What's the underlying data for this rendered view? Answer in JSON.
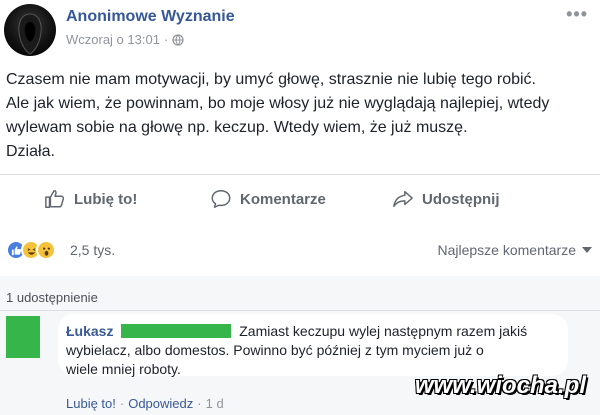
{
  "post": {
    "author": "Anonimowe Wyznanie",
    "timestamp": "Wczoraj o 13:01",
    "separator": "·",
    "more": "•••",
    "text_lines": [
      "Czasem nie mam motywacji, by umyć głowę, strasznie nie lubię tego robić.",
      "Ale jak wiem, że powinnam, bo moje włosy już nie wyglądają najlepiej, wtedy",
      "wylewam sobie na głowę np. keczup. Wtedy wiem, że już muszę.",
      "Działa."
    ]
  },
  "actions": {
    "like": "Lubię to!",
    "comment": "Komentarze",
    "share": "Udostępnij"
  },
  "reactions": {
    "types": [
      "like",
      "haha",
      "wow"
    ],
    "count": "2,5 tys.",
    "sort_label": "Najlepsze komentarze"
  },
  "shares": "1 udostępnienie",
  "comment": {
    "author": "Łukasz",
    "text_lines": [
      "Zamiast keczupu wylej następnym razem jakiś",
      "wybielacz, albo domestos. Powinno być później z tym myciem już o",
      "wiele mniej roboty."
    ],
    "like": "Lubię to!",
    "reply": "Odpowiedz",
    "time": "1 d"
  },
  "watermark": "www.wiocha.pl",
  "colors": {
    "link_blue": "#365899",
    "gray_text": "#606770",
    "redaction_green": "#36b54a",
    "comment_bg": "#f6f7f9"
  }
}
